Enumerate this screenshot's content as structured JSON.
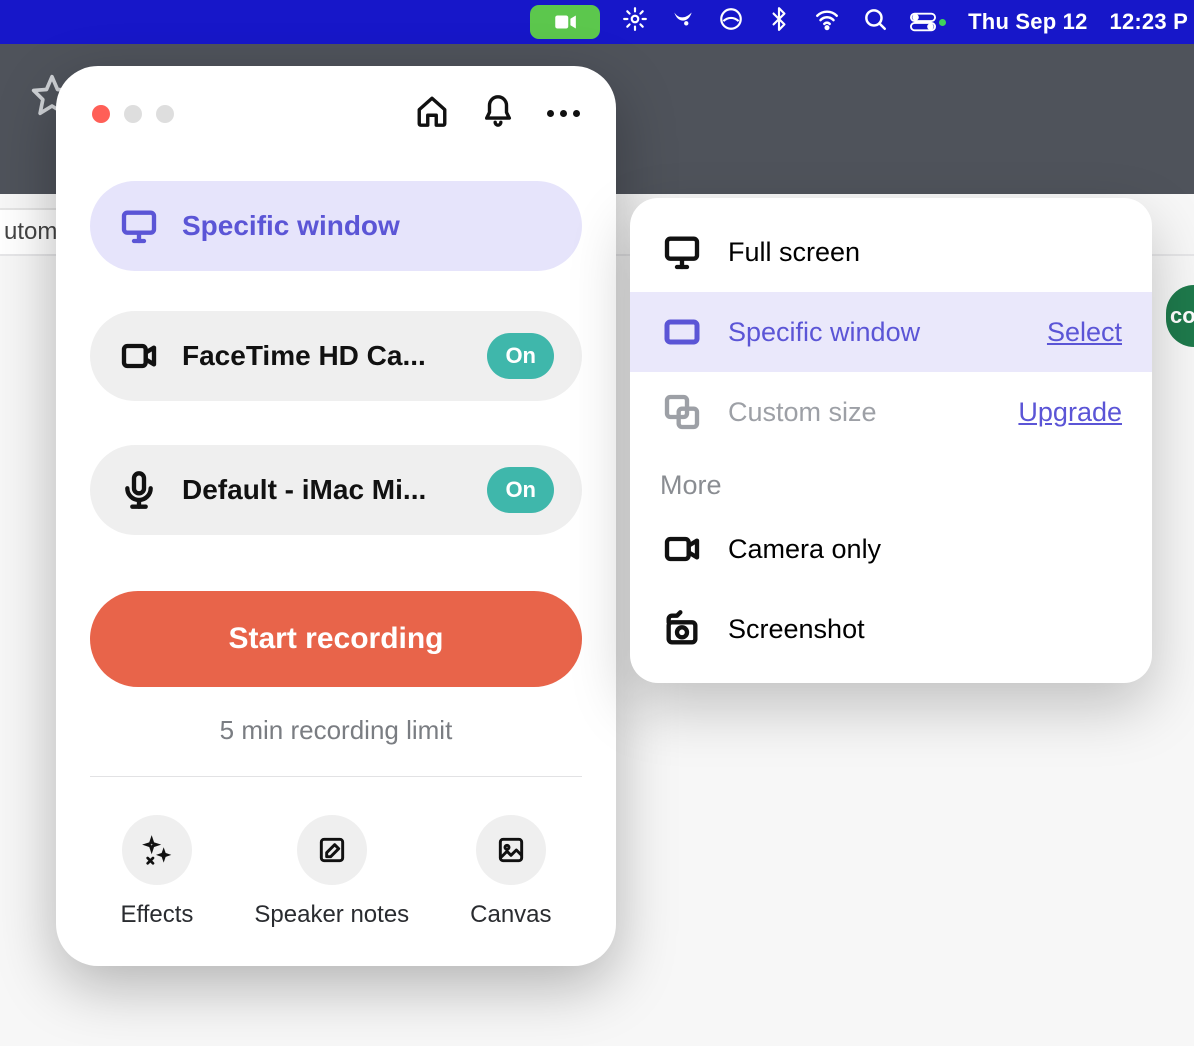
{
  "menubar": {
    "date": "Thu Sep 12",
    "time": "12:23 P"
  },
  "tabstrip_text": "utoma",
  "greenblob_text": "co",
  "panel": {
    "capture_mode_label": "Specific window",
    "camera_label": "FaceTime HD Ca...",
    "camera_state": "On",
    "mic_label": "Default - iMac Mi...",
    "mic_state": "On",
    "start_label": "Start recording",
    "limit_label": "5 min recording limit",
    "bottom": {
      "effects": "Effects",
      "notes": "Speaker notes",
      "canvas": "Canvas"
    }
  },
  "popover": {
    "full_screen": "Full screen",
    "specific_window": "Specific window",
    "select": "Select",
    "custom_size": "Custom size",
    "upgrade": "Upgrade",
    "more": "More",
    "camera_only": "Camera only",
    "screenshot": "Screenshot"
  }
}
